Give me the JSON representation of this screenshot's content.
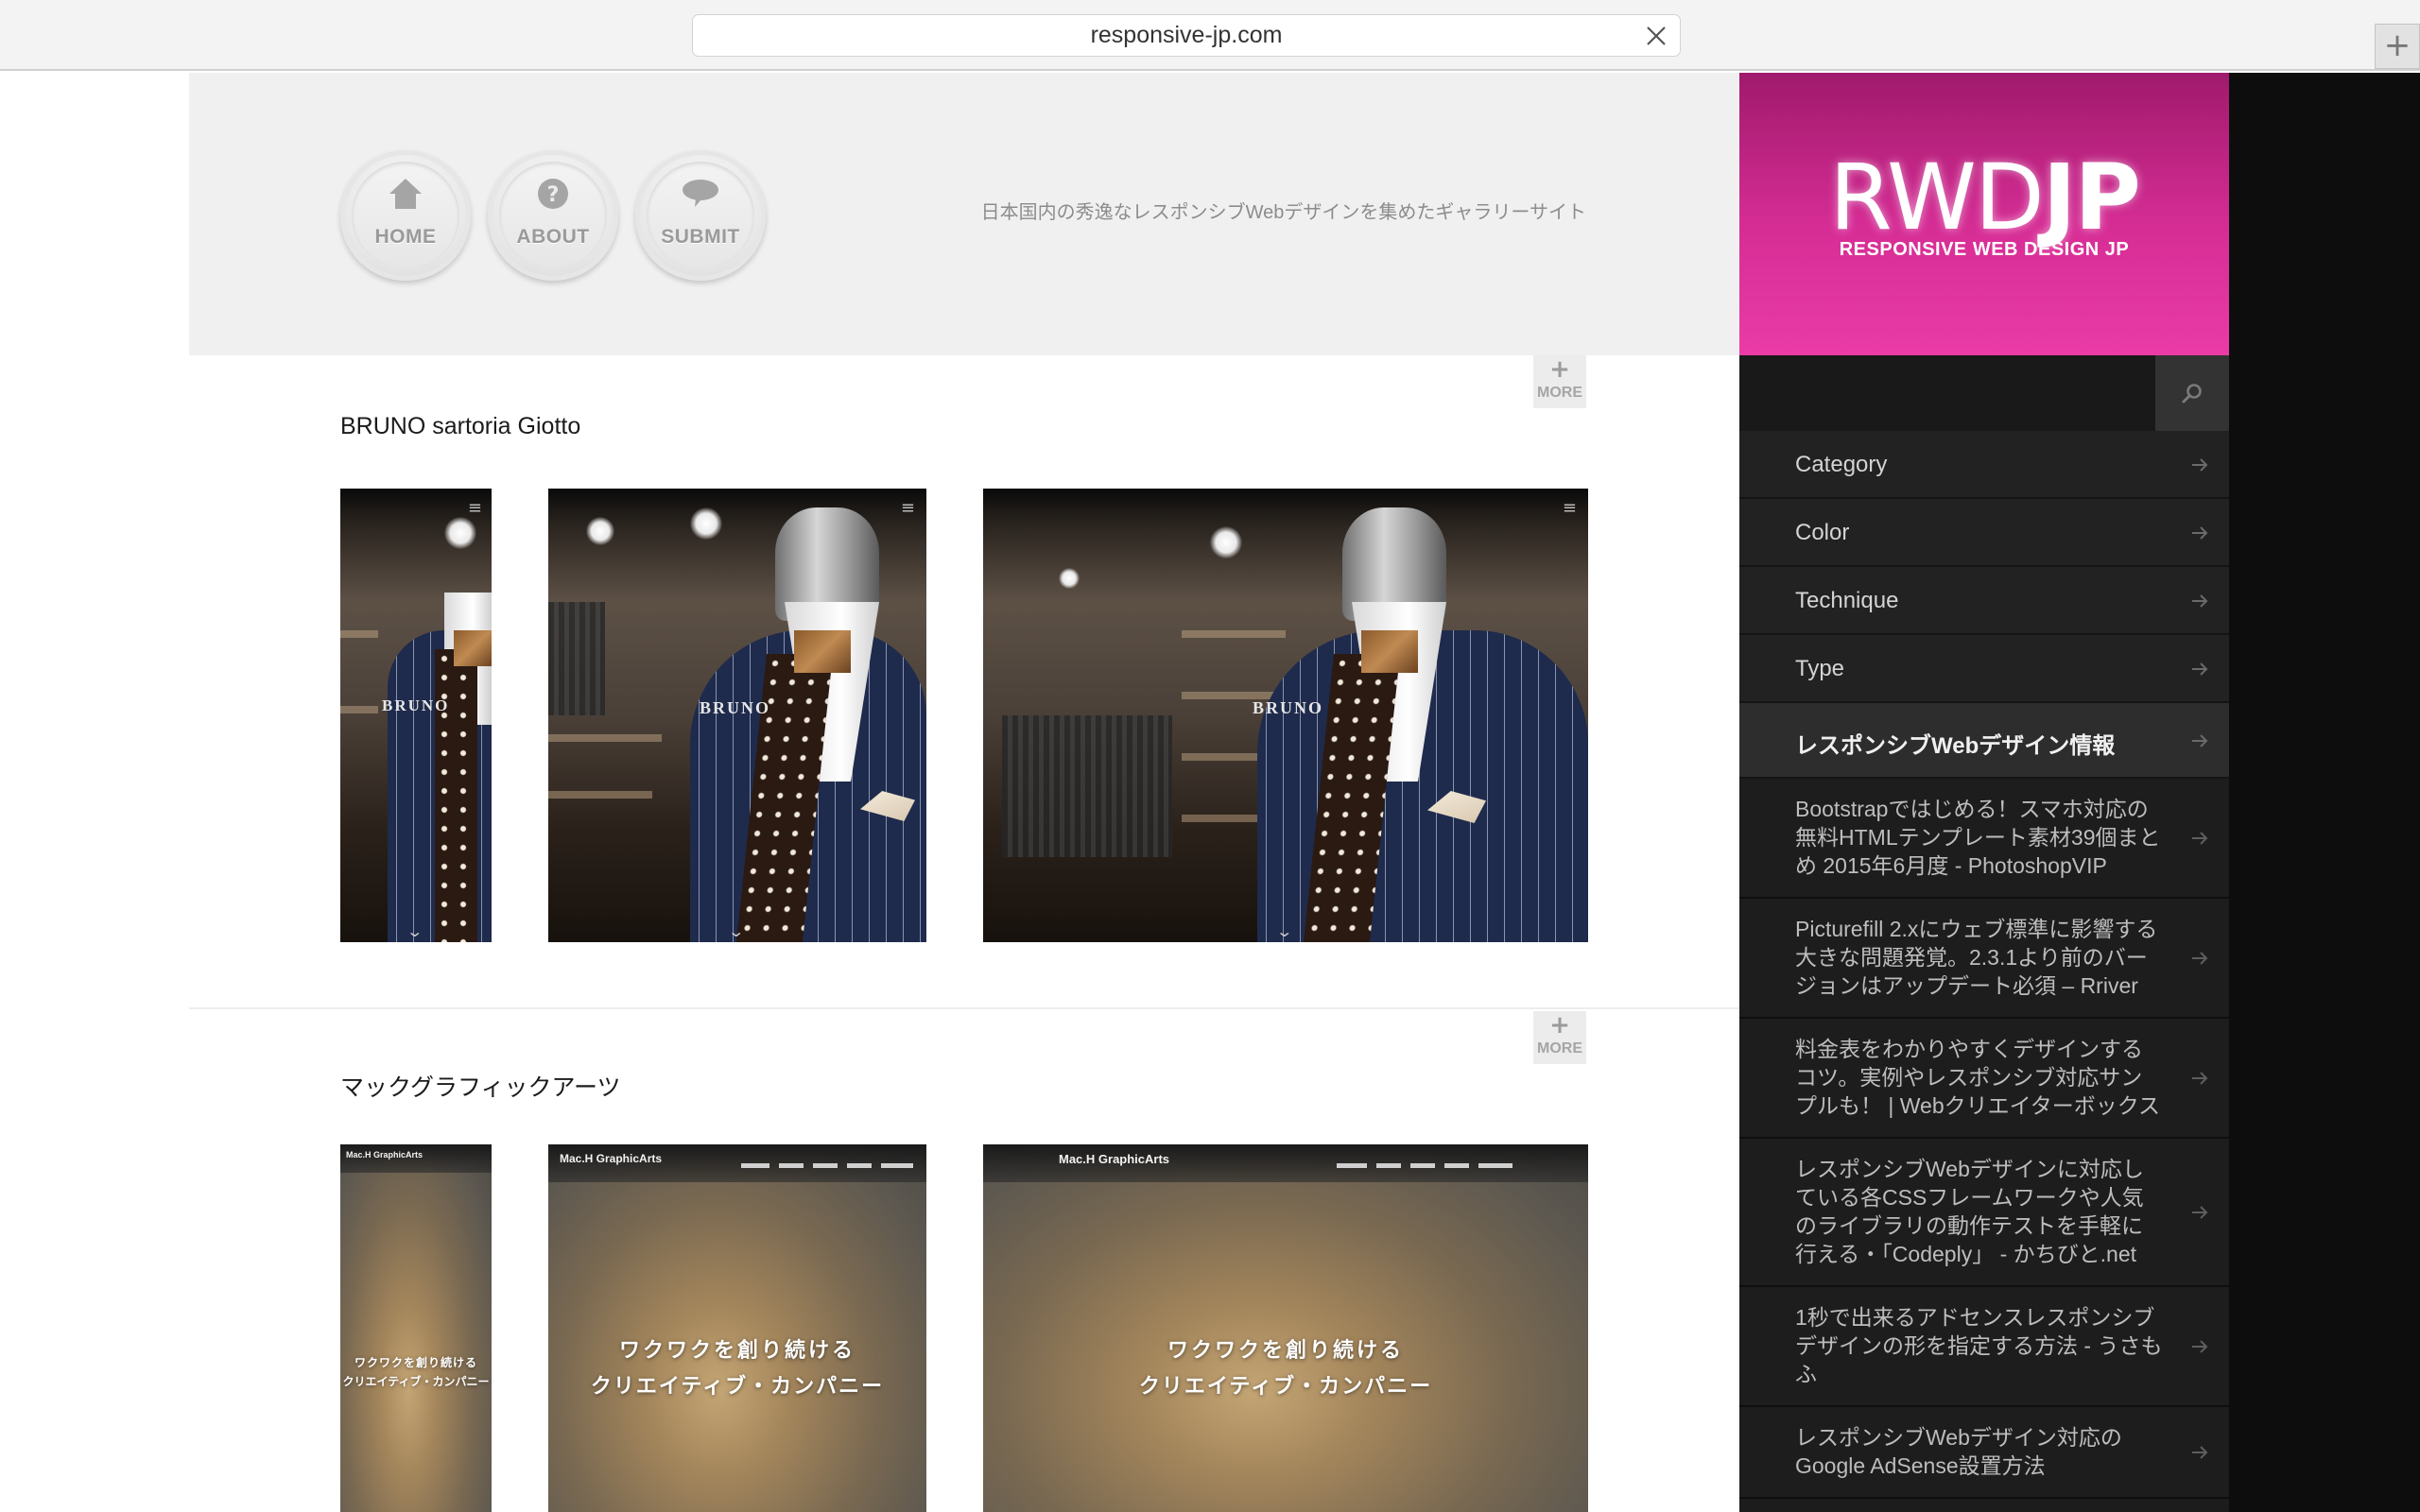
{
  "browser": {
    "url": "responsive-jp.com",
    "new_tab_label": "+"
  },
  "header": {
    "nav": [
      {
        "label": "HOME",
        "icon": "home-icon"
      },
      {
        "label": "ABOUT",
        "icon": "question-icon"
      },
      {
        "label": "SUBMIT",
        "icon": "speech-bubble-icon"
      }
    ],
    "tagline": "日本国内の秀逸なレスポンシブWebデザインを集めたギャラリーサイト"
  },
  "sections": [
    {
      "more_plus": "+",
      "more_label": "MORE",
      "title": "BRUNO sartoria Giotto",
      "brand": "BRUNO",
      "brand_sub": "sartoria Giotto"
    },
    {
      "more_plus": "+",
      "more_label": "MORE",
      "title": "マックグラフィックアーツ",
      "logo": "Mac.H GraphicArts",
      "headline_1": "ワクワクを創り続ける",
      "headline_2": "クリエイティブ・カンパニー"
    }
  ],
  "sidebar": {
    "logo_main": "RWD",
    "logo_accent": "JP",
    "logo_sub": "RESPONSIVE WEB DESIGN JP",
    "search_placeholder": "",
    "menu": [
      {
        "label": "Category"
      },
      {
        "label": "Color"
      },
      {
        "label": "Technique"
      },
      {
        "label": "Type"
      }
    ],
    "news_heading": "レスポンシブWebデザイン情報",
    "news": [
      "Bootstrapではじめる！スマホ対応の無料HTMLテンプレート素材39個まとめ 2015年6月度 - PhotoshopVIP",
      "Picturefill 2.xにウェブ標準に影響する大きな問題発覚。2.3.1より前のバージョンはアップデート必須 – Rriver",
      "料金表をわかりやすくデザインするコツ。実例やレスポンシブ対応サンプルも！ | Webクリエイターボックス",
      "レスポンシブWebデザインに対応している各CSSフレームワークや人気のライブラリの動作テストを手軽に行える・「Codeply」 - かちびと.net",
      "1秒で出来るアドセンスレスポンシブデザインの形を指定する方法 - うさもふ",
      "レスポンシブWebデザイン対応のGoogle AdSense設置方法"
    ]
  },
  "colors": {
    "brand_pink": "#e0319e",
    "sidebar_bg": "#1c1c1c",
    "header_bg": "#f0f0f0"
  }
}
